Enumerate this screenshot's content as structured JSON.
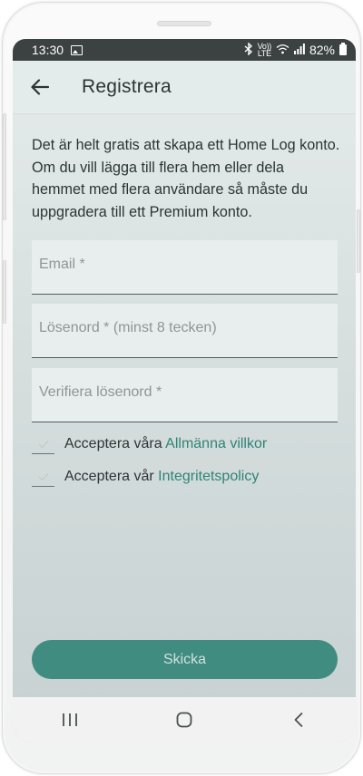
{
  "status_bar": {
    "time": "13:30",
    "icons": [
      "gallery-icon",
      "bluetooth-icon",
      "volte-icon",
      "wifi-icon",
      "signal-icon",
      "battery-icon"
    ],
    "volte_top": "Vo))",
    "volte_bottom": "LTE",
    "battery": "82%"
  },
  "app_bar": {
    "back_icon": "arrow-back-icon",
    "title": "Registrera"
  },
  "intro_text": "Det är helt gratis att skapa ett Home Log konto. Om du vill lägga till flera hem eller dela hemmet med flera användare så måste du uppgradera till ett Premium konto.",
  "form": {
    "email": {
      "placeholder": "Email *",
      "value": ""
    },
    "password": {
      "placeholder": "Lösenord * (minst 8 tecken)",
      "value": ""
    },
    "verify_password": {
      "placeholder": "Verifiera lösenord *",
      "value": ""
    },
    "terms": {
      "prefix": "Acceptera våra",
      "link": "Allmänna villkor",
      "checked": false
    },
    "privacy": {
      "prefix": "Acceptera vår",
      "link": "Integritetspolicy",
      "checked": false
    },
    "submit_label": "Skicka"
  },
  "nav_bar": {
    "recent_icon": "recent-apps-icon",
    "home_icon": "home-icon",
    "back_icon": "nav-back-icon"
  },
  "colors": {
    "accent": "#418c80",
    "link": "#2f8477",
    "status_bar": "#3c4142",
    "app_bar": "#e3ebeb"
  }
}
